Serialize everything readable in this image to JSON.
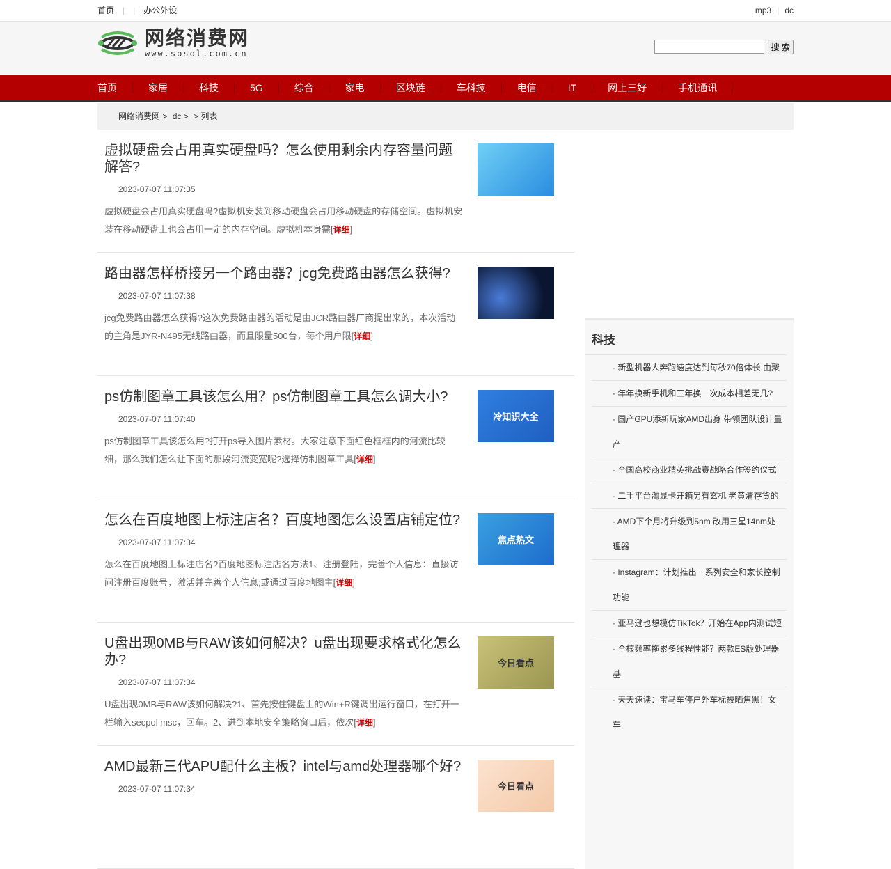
{
  "topbar": {
    "left": [
      "首页",
      "办公外设"
    ],
    "right": [
      "mp3",
      "dc"
    ]
  },
  "logo": {
    "cn": "网络消费网",
    "url": "www.sosol.com.cn"
  },
  "search": {
    "value": "",
    "button": "搜 索"
  },
  "nav": [
    "首页",
    "家居",
    "科技",
    "5G",
    "综合",
    "家电",
    "区块链",
    "车科技",
    "电信",
    "IT",
    "网上三好",
    "手机通讯"
  ],
  "breadcrumb": [
    "网络消费网 >",
    "dc >",
    "> 列表"
  ],
  "articles": [
    {
      "title": "虚拟硬盘会占用真实硬盘吗？怎么使用剩余内存容量问题解答?",
      "date": "2023-07-07 11:07:35",
      "summary": "虚拟硬盘会占用真实硬盘吗?虚拟机安装到移动硬盘会占用移动硬盘的存储空间。虚拟机安装在移动硬盘上也会占用一定的内存空间。虚拟机本身需",
      "more": "详细",
      "thumb": ""
    },
    {
      "title": "路由器怎样桥接另一个路由器？jcg免费路由器怎么获得?",
      "date": "2023-07-07 11:07:38",
      "summary": "jcg免费路由器怎么获得?这次免费路由器的活动是由JCR路由器厂商提出来的，本次活动的主角是JYR-N495无线路由器，而且限量500台，每个用户限",
      "more": "详细",
      "thumb": ""
    },
    {
      "title": "ps仿制图章工具该怎么用？ps仿制图章工具怎么调大小?",
      "date": "2023-07-07 11:07:40",
      "summary": "ps仿制图章工具该怎么用?打开ps导入图片素材。大家注意下面红色框框内的河流比较细，那么我们怎么让下面的那段河流变宽呢?选择仿制图章工具",
      "more": "详细",
      "thumb": "冷知识大全"
    },
    {
      "title": "怎么在百度地图上标注店名？百度地图怎么设置店铺定位?",
      "date": "2023-07-07 11:07:34",
      "summary": "怎么在百度地图上标注店名?百度地图标注店名方法1、注册登陆，完善个人信息：直接访问注册百度账号，激活并完善个人信息;或通过百度地图主",
      "more": "详细",
      "thumb": "焦点热文"
    },
    {
      "title": "U盘出现0MB与RAW该如何解决？u盘出现要求格式化怎么办?",
      "date": "2023-07-07 11:07:34",
      "summary": "U盘出现0MB与RAW该如何解决?1、首先按住键盘上的Win+R键调出运行窗口，在打开一栏输入secpol msc，回车。2、进到本地安全策略窗口后，依次",
      "more": "详细",
      "thumb": "今日看点"
    },
    {
      "title": "AMD最新三代APU配什么主板？intel与amd处理器哪个好?",
      "date": "2023-07-07 11:07:34",
      "summary": "",
      "more": "",
      "thumb": "今日看点"
    }
  ],
  "sidebar": {
    "title": "科技",
    "items": [
      "· 新型机器人奔跑速度达到每秒70倍体长 由聚",
      "· 年年换新手机和三年换一次成本相差无几?",
      "· 国产GPU添新玩家AMD出身 带领团队设计量产",
      "· 全国高校商业精英挑战赛战略合作签约仪式",
      "· 二手平台淘显卡开箱另有玄机 老黄清存货的",
      "· AMD下个月将升级到5nm 改用三星14nm处理器",
      "· Instagram：计划推出一系列安全和家长控制功能",
      "· 亚马逊也想模仿TikTok？开始在App内测试短",
      "· 全核频率拖累多线程性能？两款ES版处理器基",
      "· 天天速读：宝马车停户外车标被晒焦黑！女车"
    ]
  }
}
